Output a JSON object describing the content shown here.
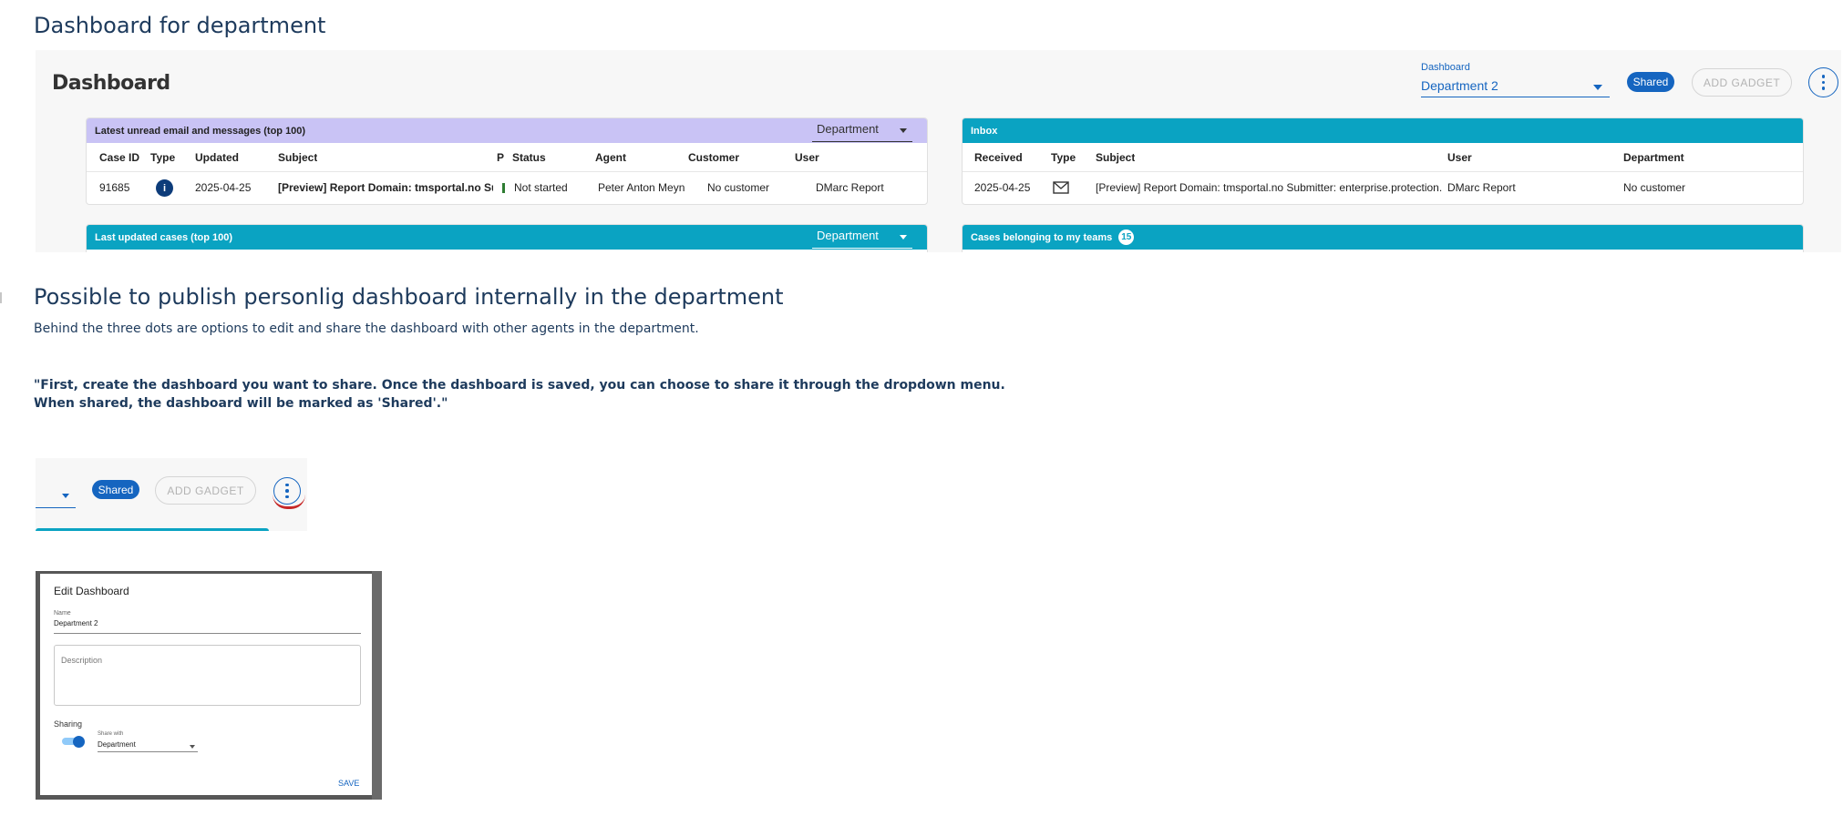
{
  "page_title": "Dashboard for department",
  "dashboard": {
    "title": "Dashboard",
    "select_label": "Dashboard",
    "select_value": "Department 2",
    "shared_badge": "Shared",
    "add_gadget": "ADD GADGET",
    "panels": {
      "unread": {
        "title": "Latest unread email and messages (top 100)",
        "filter": "Department",
        "columns": [
          "Case ID",
          "Type",
          "Updated",
          "Subject",
          "P",
          "Status",
          "Agent",
          "Customer",
          "User"
        ],
        "row": {
          "case_id": "91685",
          "type_icon": "i",
          "updated": "2025-04-25",
          "subject": "[Preview] Report Domain: tmsportal.no Sub",
          "status": "Not started",
          "agent": "Peter Anton Meyn",
          "customer": "No customer",
          "user": "DMarc Report"
        }
      },
      "inbox": {
        "title": "Inbox",
        "columns": [
          "Received",
          "Type",
          "Subject",
          "User",
          "Department"
        ],
        "row": {
          "received": "2025-04-25",
          "subject": "[Preview] Report Domain: tmsportal.no Submitter: enterprise.protection.",
          "user": "DMarc Report",
          "department": "No customer"
        }
      },
      "last_updated": {
        "title": "Last updated cases (top 100)",
        "filter": "Department"
      },
      "my_teams": {
        "title": "Cases belonging to my teams",
        "count": "15"
      }
    }
  },
  "section2": {
    "heading": "Possible to publish personlig dashboard internally in the department",
    "description": "Behind the three dots are options to edit and share the dashboard with other agents in the department.",
    "quote_line1": "\"First, create the dashboard you want to share. Once the dashboard is saved, you can choose to share it through the dropdown menu.",
    "quote_line2": "When shared, the dashboard will be marked as 'Shared'.\""
  },
  "crop": {
    "shared_badge": "Shared",
    "add_gadget": "ADD GADGET"
  },
  "edit_dialog": {
    "title": "Edit Dashboard",
    "name_label": "Name",
    "name_value": "Department 2",
    "description_placeholder": "Description",
    "sharing_label": "Sharing",
    "sharing_enabled": true,
    "share_with_label": "Share with",
    "share_with_value": "Department",
    "save": "SAVE"
  },
  "colors": {
    "primary": "#1565c0",
    "teal_header": "#0aa3c2",
    "purple_header": "#c9c3f5",
    "heading_text": "#1d3a5c",
    "highlight_red": "#c62828"
  }
}
